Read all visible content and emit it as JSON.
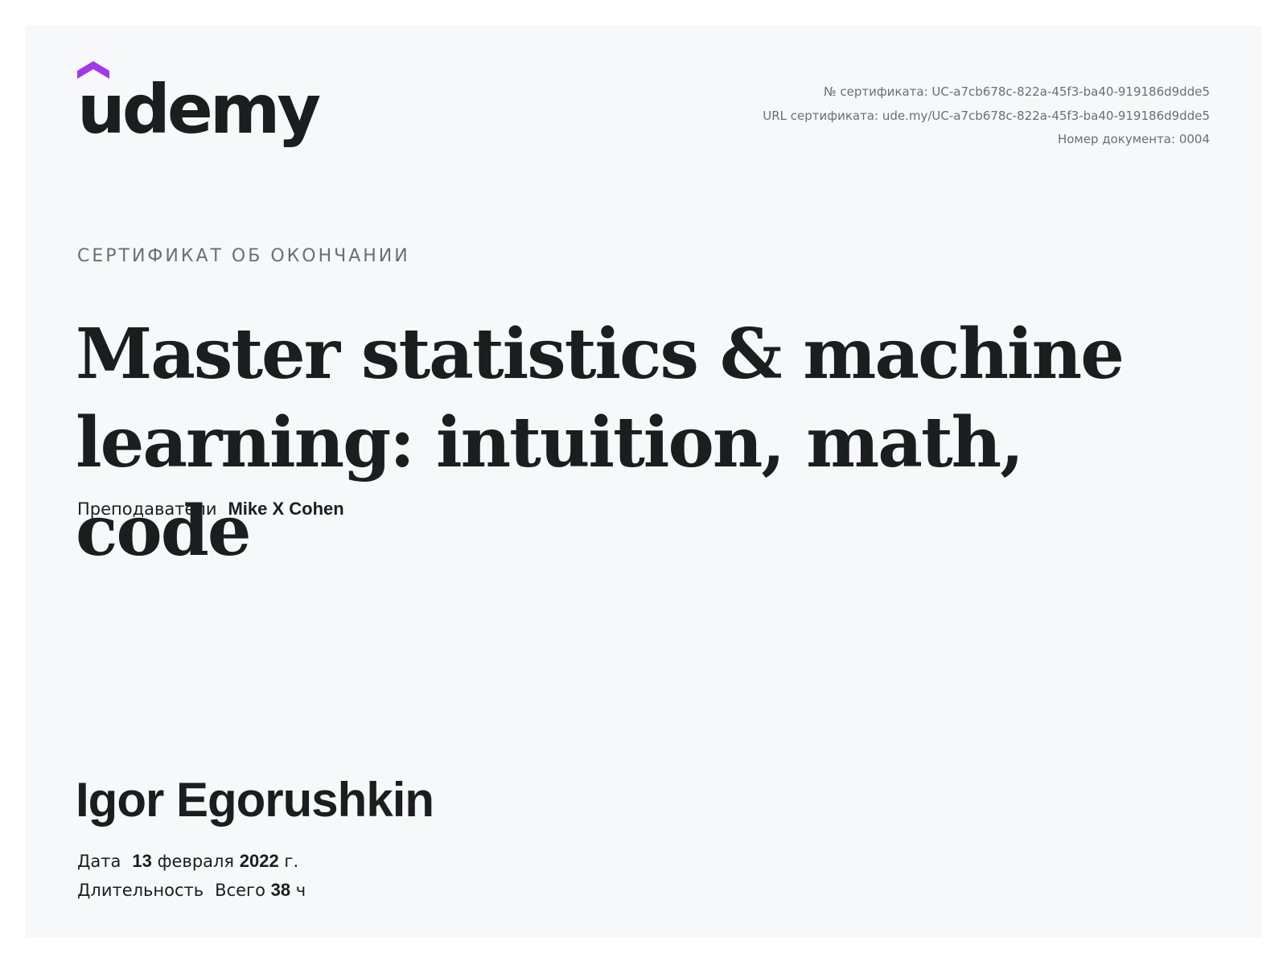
{
  "logo": {
    "text": "udemy",
    "brand_color": "#a435f0"
  },
  "meta": {
    "certificate_number": "№ сертификата: UC-a7cb678c-822a-45f3-ba40-919186d9dde5",
    "certificate_url": "URL сертификата: ude.my/UC-a7cb678c-822a-45f3-ba40-919186d9dde5",
    "document_number": "Номер документа: 0004"
  },
  "eyebrow": "СЕРТИФИКАТ ОБ ОКОНЧАНИИ",
  "course": {
    "title": "Master statistics & machine learning: intuition, math, code"
  },
  "instructors": {
    "label": "Преподаватели",
    "name": "Mike X Cohen"
  },
  "student": {
    "name": "Igor Egorushkin"
  },
  "date": {
    "label": "Дата",
    "day": "13",
    "month": "февраля",
    "year": "2022",
    "suffix": "г."
  },
  "duration": {
    "label": "Длительность",
    "prefix": "Всего",
    "hours": "38",
    "unit": "ч"
  }
}
